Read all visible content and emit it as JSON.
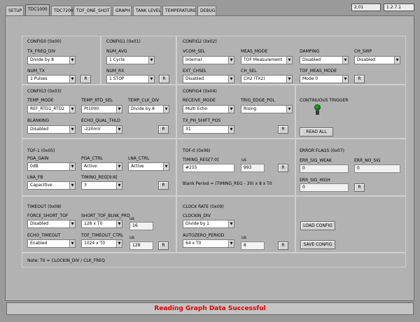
{
  "tabs": [
    "SETUP",
    "TDC1000",
    "TDC7200",
    "TOF_ONE_SHOT",
    "GRAPH",
    "TANK LEVEL",
    "TEMPERATURE",
    "DEBUG"
  ],
  "active_tab": "TDC1000",
  "top_right": {
    "coord": "2,01",
    "version": "1.2.7.1"
  },
  "config0": {
    "title": "CONFIG0 (0x00)",
    "tx_freq_div": {
      "label": "TX_FREQ_DIV",
      "value": "Divide by 8"
    },
    "num_tx": {
      "label": "NUM_TX",
      "value": "1 Pulses"
    }
  },
  "config1": {
    "title": "CONFIG1 (0x01)",
    "num_avg": {
      "label": "NUM_AVG",
      "value": "1 Cycle"
    },
    "num_rx": {
      "label": "NUM_RX",
      "value": "1 STOP"
    }
  },
  "config2": {
    "title": "CONFIG2 (0x02)",
    "vcom_sel": {
      "label": "VCOM_SEL",
      "value": "Internal"
    },
    "meas_mode": {
      "label": "MEAS_MODE",
      "value": "TOF Measurement"
    },
    "damping": {
      "label": "DAMPING",
      "value": "Disabled"
    },
    "ch_swp": {
      "label": "CH_SWP",
      "value": "Disabled"
    },
    "ext_chsel": {
      "label": "EXT_CHSEL",
      "value": "Disabled"
    },
    "ch_sel": {
      "label": "CH_SEL",
      "value": "CH2 (TX2)"
    },
    "tof_meas_mode": {
      "label": "TOF_MEAS_MODE",
      "value": "Mode 0"
    }
  },
  "config3": {
    "title": "CONFIG3 (0x03)",
    "temp_mode": {
      "label": "TEMP_MODE",
      "value": "REF_RTD1_RTD2"
    },
    "temp_rtd_sel": {
      "label": "TEMP_RTD_SEL",
      "value": "Pt1000"
    },
    "temp_clk_div": {
      "label": "TEMP_CLK_DIV",
      "value": "Divide by 8"
    },
    "blanking": {
      "label": "BLANKING",
      "value": "Disabled"
    },
    "echo_qual_thld": {
      "label": "ECHO_QUAL_THLD",
      "value": "-220mV"
    }
  },
  "config4": {
    "title": "CONFIG4 (0x04)",
    "receive_mode": {
      "label": "RECEIVE_MODE",
      "value": "Multi Echo"
    },
    "trig_edge_pol": {
      "label": "TRIG_EDGE_POL",
      "value": "Rising"
    },
    "tx_ph_shift_pos": {
      "label": "TX_PH_SHIFT_POS",
      "value": "31"
    }
  },
  "continuous": {
    "label": "CONTINUOUS TRIGGER",
    "read_all": "READ ALL"
  },
  "tof1": {
    "title": "TOF-1 (0x05)",
    "pga_gain": {
      "label": "PGA_GAIN",
      "value": "0dB"
    },
    "pga_ctrl": {
      "label": "PGA_CTRL",
      "value": "Active"
    },
    "lna_ctrl": {
      "label": "LNA_CTRL",
      "value": "Active"
    },
    "lna_fb": {
      "label": "LNA_FB",
      "value": "Capacitive"
    },
    "timing_reg_98": {
      "label": "TIMING_REG[9:8]",
      "value": "3"
    }
  },
  "tof0": {
    "title": "TOF-0 (0x06)",
    "timing_reg_70": {
      "label": "TIMING_REG[7:0]",
      "value": "#255"
    },
    "us_label": "us",
    "us_value": "993",
    "note": "Blank Period = (TIMING_REG - 30) x 8 x T0"
  },
  "error_flags": {
    "title": "ERROR FLAGS (0x07)",
    "err_sig_weak": {
      "label": "ERR_SIG_WEAK",
      "value": "0"
    },
    "err_no_sig": {
      "label": "ERR_NO_SIG",
      "value": "0"
    },
    "err_sig_high": {
      "label": "ERR_SIG_HIGH",
      "value": "0"
    }
  },
  "timeout": {
    "title": "TIMEOUT (0x08)",
    "force_short_tof": {
      "label": "FORCE_SHORT_TOF",
      "value": "Disabled"
    },
    "short_tof_blnk_prd": {
      "label": "SHORT_TOF_BLNK_PRD",
      "value": "128 x T0"
    },
    "us1_label": "us",
    "us1_value": "16",
    "echo_timeout": {
      "label": "ECHO_TIMEOUT",
      "value": "Enabled"
    },
    "tof_timeout_ctrl": {
      "label": "TOF_TIMEOUT_CTRL",
      "value": "1024 x T0"
    },
    "us2_label": "us",
    "us2_value": "128"
  },
  "clock_rate": {
    "title": "CLOCK RATE (0x09)",
    "clockin_div": {
      "label": "CLOCKIN_DIV",
      "value": "Divide by 1"
    },
    "autozero_period": {
      "label": "AUTOZERO_PERIOD",
      "value": "64 x T0"
    },
    "us_label": "us",
    "us_value": "8"
  },
  "buttons": {
    "load": "LOAD CONFIG",
    "save": "SAVE CONFIG",
    "refresh": "R"
  },
  "note": "Note: T0 = CLOCKIN_DIV / CLK_FREQ",
  "status": "Reading Graph Data Successful",
  "colors": {
    "status_text": "#e00000",
    "led": "#1fa51f",
    "background": "#b2b2b2"
  }
}
